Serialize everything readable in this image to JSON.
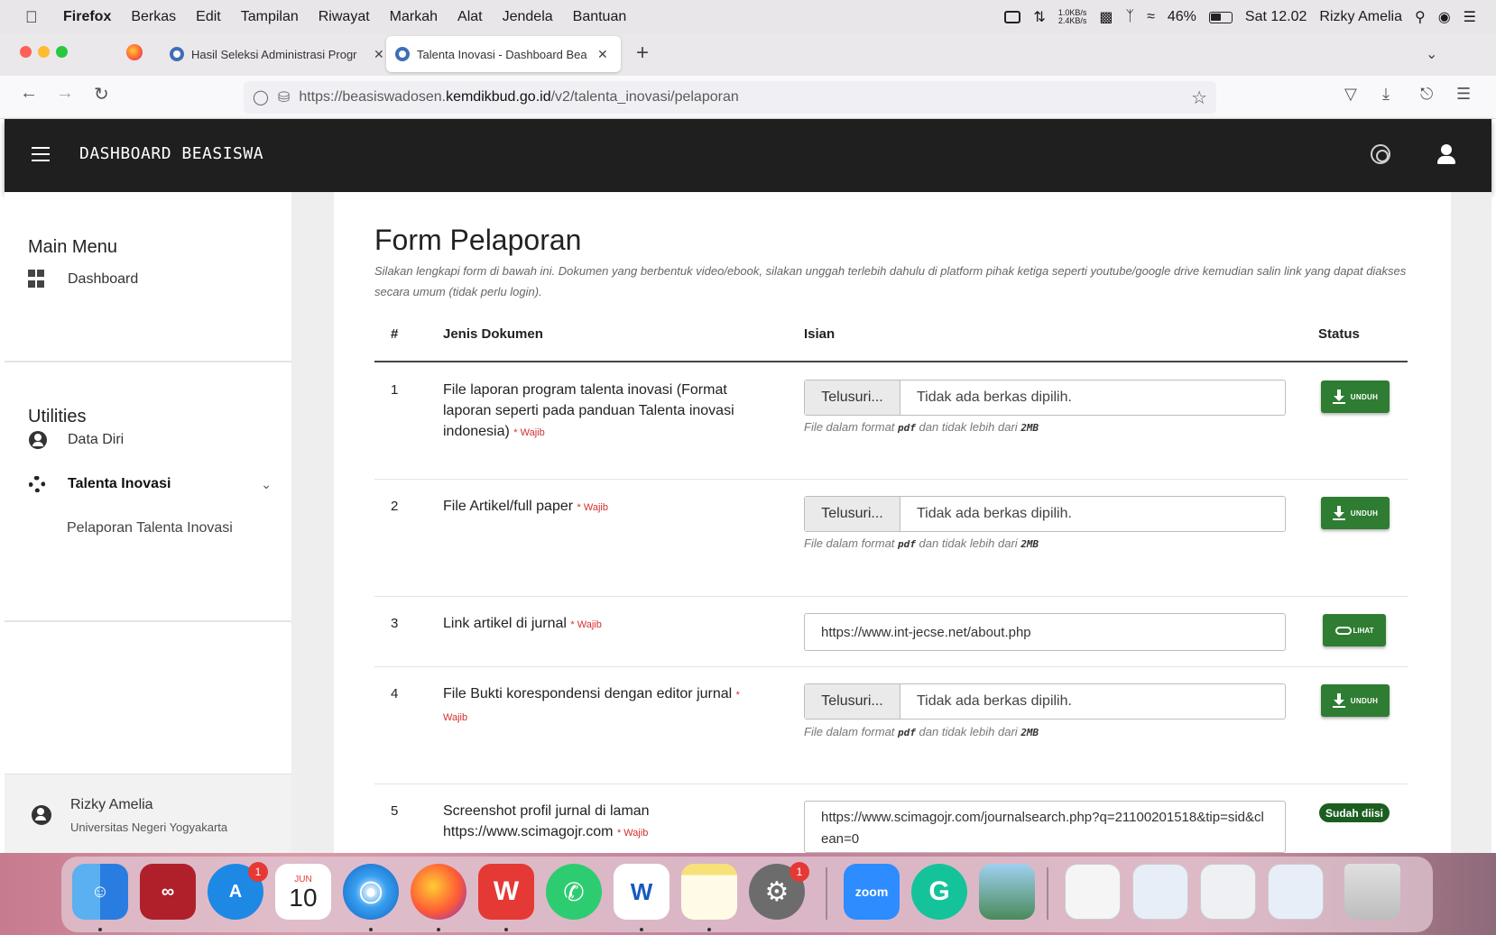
{
  "menubar": {
    "app": "Firefox",
    "items": [
      "Berkas",
      "Edit",
      "Tampilan",
      "Riwayat",
      "Markah",
      "Alat",
      "Jendela",
      "Bantuan"
    ],
    "net_up": "1.0KB/s",
    "net_down": "2.4KB/s",
    "battery": "46%",
    "clock": "Sat 12.02",
    "user": "Rizky Amelia"
  },
  "browser": {
    "tabs": [
      {
        "label": "Hasil Seleksi Administrasi Progr"
      },
      {
        "label": "Talenta Inovasi - Dashboard Bea"
      }
    ],
    "url_prefix": "https://beasiswadosen.",
    "url_host": "kemdikbud.go.id",
    "url_path": "/v2/talenta_inovasi/pelaporan"
  },
  "header": {
    "title": "DASHBOARD BEASISWA"
  },
  "sidebar": {
    "main_menu": "Main Menu",
    "dashboard": "Dashboard",
    "utilities": "Utilities",
    "data_diri": "Data Diri",
    "talenta_inovasi": "Talenta Inovasi",
    "pelaporan": "Pelaporan Talenta Inovasi",
    "user_name": "Rizky Amelia",
    "user_org": "Universitas Negeri Yogyakarta"
  },
  "form": {
    "title": "Form Pelaporan",
    "description": "Silakan lengkapi form di bawah ini. Dokumen yang berbentuk video/ebook, silakan unggah terlebih dahulu di platform pihak ketiga seperti youtube/google drive kemudian salin link yang dapat diakses secara umum (tidak perlu login).",
    "columns": {
      "num": "#",
      "doc": "Jenis Dokumen",
      "fill": "Isian",
      "status": "Status"
    },
    "required": "* Wajib",
    "browse": "Telusuri...",
    "no_file": "Tidak ada berkas dipilih.",
    "hint_prefix": "File dalam format",
    "hint_fmt": "pdf",
    "hint_mid": "dan tidak lebih dari",
    "hint_size": "2MB",
    "unduh": "UNDUH",
    "lihat": "LIHAT",
    "rows": [
      {
        "num": "1",
        "doc": "File laporan program talenta inovasi (Format laporan seperti pada panduan Talenta inovasi indonesia)"
      },
      {
        "num": "2",
        "doc": "File Artikel/full paper"
      },
      {
        "num": "3",
        "doc": "Link artikel di jurnal",
        "value": "https://www.int-jecse.net/about.php"
      },
      {
        "num": "4",
        "doc": "File Bukti korespondensi dengan editor jurnal"
      },
      {
        "num": "5",
        "doc": "Screenshot profil jurnal di laman https://www.scimagojr.com",
        "value": "https://www.scimagojr.com/journalsearch.php?q=21100201518&tip=sid&clean=0",
        "status": "Sudah diisi"
      }
    ]
  },
  "dock": {
    "calendar_month": "JUN",
    "calendar_day": "10",
    "appstore_badge": "1",
    "settings_badge": "1",
    "zoom_label": "zoom"
  }
}
